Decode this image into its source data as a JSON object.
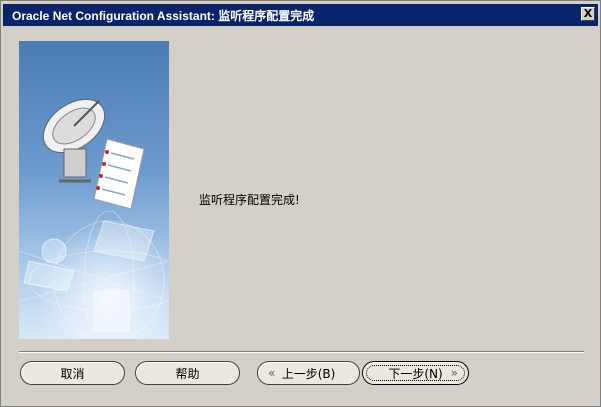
{
  "window": {
    "title": "Oracle Net Configuration Assistant: 监听程序配置完成",
    "close_label": "X"
  },
  "main": {
    "message": "监听程序配置完成!"
  },
  "buttons": {
    "cancel": "取消",
    "help": "帮助",
    "back": "上一步(B)",
    "next": "下一步(N)"
  },
  "icons": {
    "back": "chevron-left-icon",
    "next": "chevron-right-icon",
    "side_art": "satellite-dish-illustration"
  },
  "colors": {
    "titlebar": "#0a246a",
    "dialog": "#d4d0c8",
    "side_panel_top": "#4f7fb7",
    "side_panel_bottom": "#cfe1f5"
  }
}
